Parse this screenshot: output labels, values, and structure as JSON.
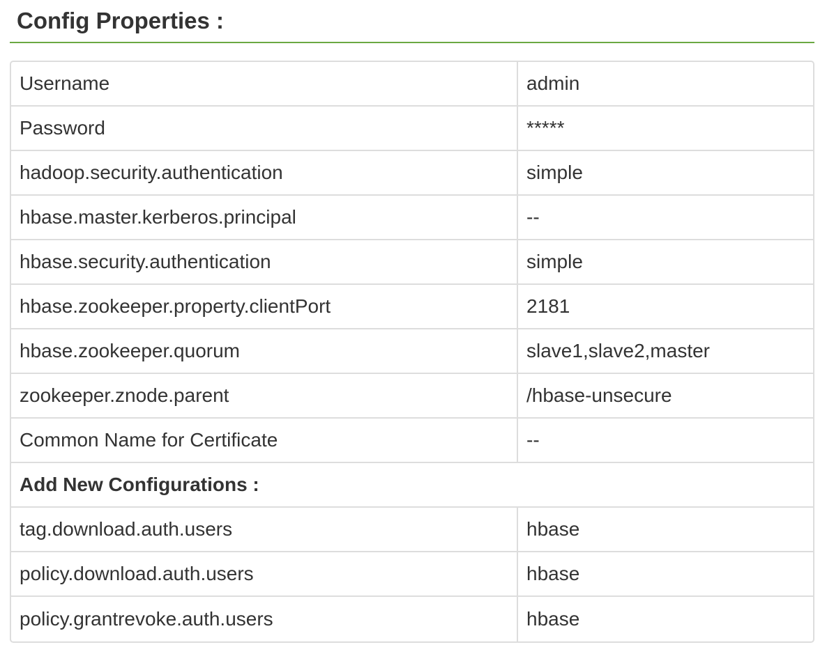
{
  "header": {
    "title": "Config Properties :",
    "accent_color": "#6aa842"
  },
  "properties": [
    {
      "key": "Username",
      "value": "admin"
    },
    {
      "key": "Password",
      "value": "*****"
    },
    {
      "key": "hadoop.security.authentication",
      "value": "simple"
    },
    {
      "key": "hbase.master.kerberos.principal",
      "value": "--"
    },
    {
      "key": "hbase.security.authentication",
      "value": "simple"
    },
    {
      "key": "hbase.zookeeper.property.clientPort",
      "value": "2181"
    },
    {
      "key": "hbase.zookeeper.quorum",
      "value": "slave1,slave2,master"
    },
    {
      "key": "zookeeper.znode.parent",
      "value": "/hbase-unsecure"
    },
    {
      "key": "Common Name for Certificate",
      "value": "--"
    }
  ],
  "new_configs": {
    "heading": "Add New Configurations :",
    "rows": [
      {
        "key": "tag.download.auth.users",
        "value": "hbase"
      },
      {
        "key": "policy.download.auth.users",
        "value": "hbase"
      },
      {
        "key": "policy.grantrevoke.auth.users",
        "value": "hbase"
      }
    ]
  }
}
